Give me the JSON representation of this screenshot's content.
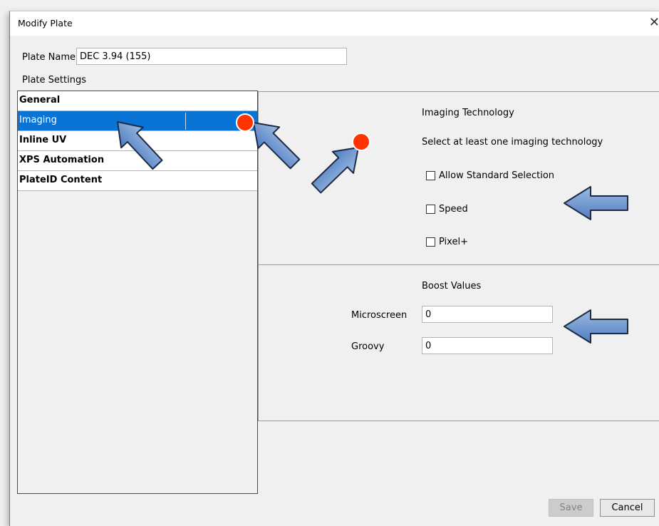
{
  "dialog": {
    "title": "Modify Plate",
    "close_glyph": "✕"
  },
  "plate_name": {
    "label": "Plate Name",
    "value": "DEC 3.94 (155)"
  },
  "plate_settings_label": "Plate Settings",
  "settings_list": {
    "items": [
      {
        "label": "General",
        "selected": false
      },
      {
        "label": "Imaging",
        "selected": true
      },
      {
        "label": "Inline UV",
        "selected": false
      },
      {
        "label": "XPS Automation",
        "selected": false
      },
      {
        "label": "PlateID Content",
        "selected": false
      }
    ]
  },
  "imaging": {
    "heading": "Imaging Technology",
    "instruction": "Select at least one imaging technology",
    "options": [
      {
        "label": "Allow Standard Selection",
        "checked": false
      },
      {
        "label": "Speed",
        "checked": false
      },
      {
        "label": "Pixel+",
        "checked": false
      }
    ]
  },
  "boost": {
    "heading": "Boost Values",
    "microscreen_label": "Microscreen",
    "microscreen_value": "0",
    "groovy_label": "Groovy",
    "groovy_value": "0"
  },
  "buttons": {
    "save": "Save",
    "cancel": "Cancel"
  },
  "colors": {
    "selection": "#0a74d6",
    "annotation_arrow": "#6f95c9",
    "annotation_dot": "#ff3300"
  }
}
